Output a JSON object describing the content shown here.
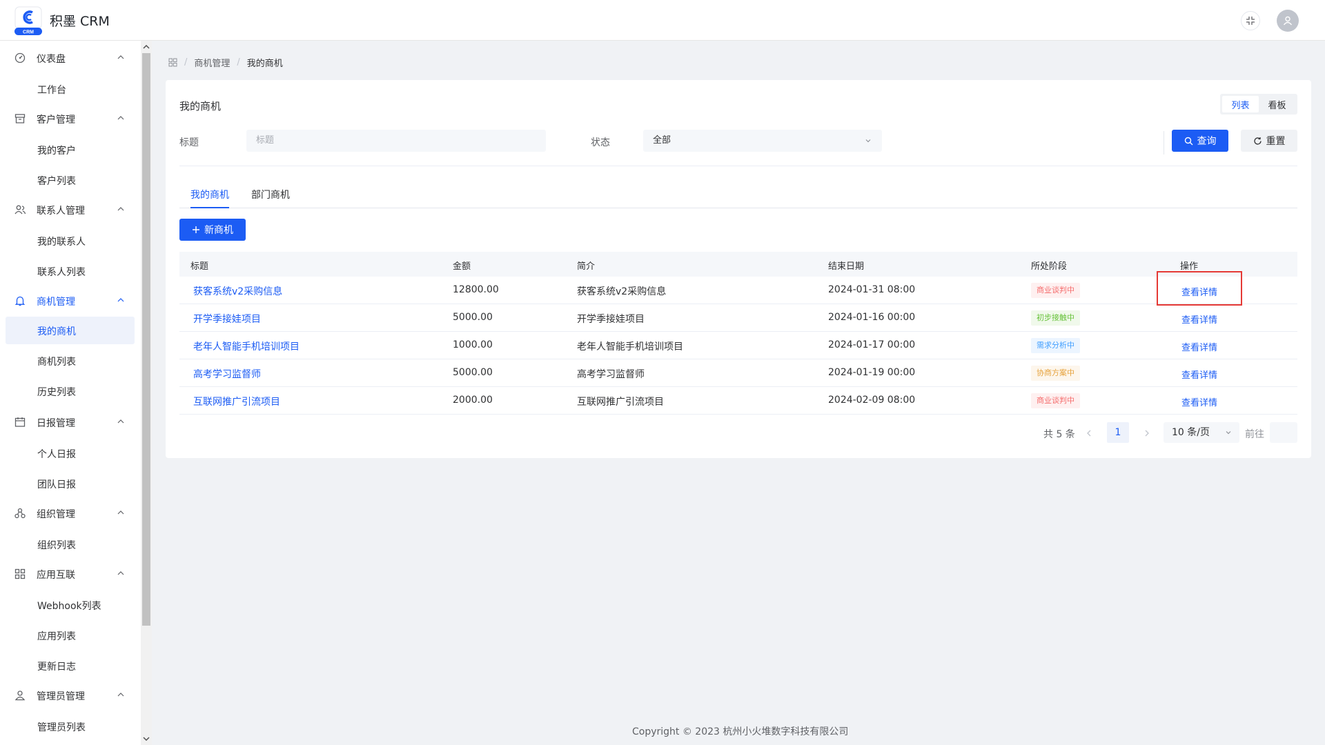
{
  "app": {
    "title": "积墨 CRM",
    "logo_badge": "CRM"
  },
  "header": {
    "fullscreen_icon": "fullscreen-icon",
    "avatar_icon": "user-icon"
  },
  "sidebar": {
    "groups": [
      {
        "label": "仪表盘",
        "icon": "dashboard-icon",
        "items": [
          "工作台"
        ]
      },
      {
        "label": "客户管理",
        "icon": "archive-icon",
        "items": [
          "我的客户",
          "客户列表"
        ]
      },
      {
        "label": "联系人管理",
        "icon": "contacts-icon",
        "items": [
          "我的联系人",
          "联系人列表"
        ]
      },
      {
        "label": "商机管理",
        "icon": "bell-icon",
        "items": [
          "我的商机",
          "商机列表",
          "历史列表"
        ]
      },
      {
        "label": "日报管理",
        "icon": "calendar-icon",
        "items": [
          "个人日报",
          "团队日报"
        ]
      },
      {
        "label": "组织管理",
        "icon": "org-icon",
        "items": [
          "组织列表"
        ]
      },
      {
        "label": "应用互联",
        "icon": "grid-icon",
        "items": [
          "Webhook列表",
          "应用列表",
          "更新日志"
        ]
      },
      {
        "label": "管理员管理",
        "icon": "admin-icon",
        "items": [
          "管理员列表"
        ]
      }
    ],
    "active_group": "商机管理",
    "active_item": "我的商机"
  },
  "breadcrumb": {
    "items": [
      "商机管理",
      "我的商机"
    ],
    "separator": "/"
  },
  "card": {
    "title": "我的商机",
    "view_switch": {
      "list": "列表",
      "board": "看板",
      "active": "列表"
    },
    "filters": {
      "title_label": "标题",
      "title_placeholder": "标题",
      "status_label": "状态",
      "status_value": "全部"
    },
    "buttons": {
      "search": "查询",
      "reset": "重置",
      "new": "新商机"
    },
    "tabs": [
      "我的商机",
      "部门商机"
    ],
    "active_tab": "我的商机"
  },
  "table": {
    "columns": [
      "标题",
      "金额",
      "简介",
      "结束日期",
      "所处阶段",
      "操作"
    ],
    "rows": [
      {
        "title": "获客系统v2采购信息",
        "amount": "12800.00",
        "intro": "获客系统v2采购信息",
        "end_date": "2024-01-31 08:00",
        "stage": "商业谈判中",
        "stage_color": "#f56c6c",
        "stage_bg": "#fef0f0",
        "action": "查看详情"
      },
      {
        "title": "开学季接娃项目",
        "amount": "5000.00",
        "intro": "开学季接娃项目",
        "end_date": "2024-01-16 00:00",
        "stage": "初步接触中",
        "stage_color": "#67c23a",
        "stage_bg": "#f0f9eb",
        "action": "查看详情"
      },
      {
        "title": "老年人智能手机培训项目",
        "amount": "1000.00",
        "intro": "老年人智能手机培训项目",
        "end_date": "2024-01-17 00:00",
        "stage": "需求分析中",
        "stage_color": "#409eff",
        "stage_bg": "#ecf5ff",
        "action": "查看详情"
      },
      {
        "title": "高考学习监督师",
        "amount": "5000.00",
        "intro": "高考学习监督师",
        "end_date": "2024-01-19 00:00",
        "stage": "协商方案中",
        "stage_color": "#e6a23c",
        "stage_bg": "#fdf6ec",
        "action": "查看详情"
      },
      {
        "title": "互联网推广引流项目",
        "amount": "2000.00",
        "intro": "互联网推广引流项目",
        "end_date": "2024-02-09 08:00",
        "stage": "商业谈判中",
        "stage_color": "#f56c6c",
        "stage_bg": "#fef0f0",
        "action": "查看详情"
      }
    ]
  },
  "pagination": {
    "total": "共 5 条",
    "current_page": "1",
    "page_size": "10 条/页",
    "goto_label": "前往"
  },
  "footer": {
    "copyright": "Copyright © 2023 杭州小火堆数字科技有限公司"
  },
  "colors": {
    "primary": "#1c5cf4",
    "highlight_box": "#e53935"
  }
}
